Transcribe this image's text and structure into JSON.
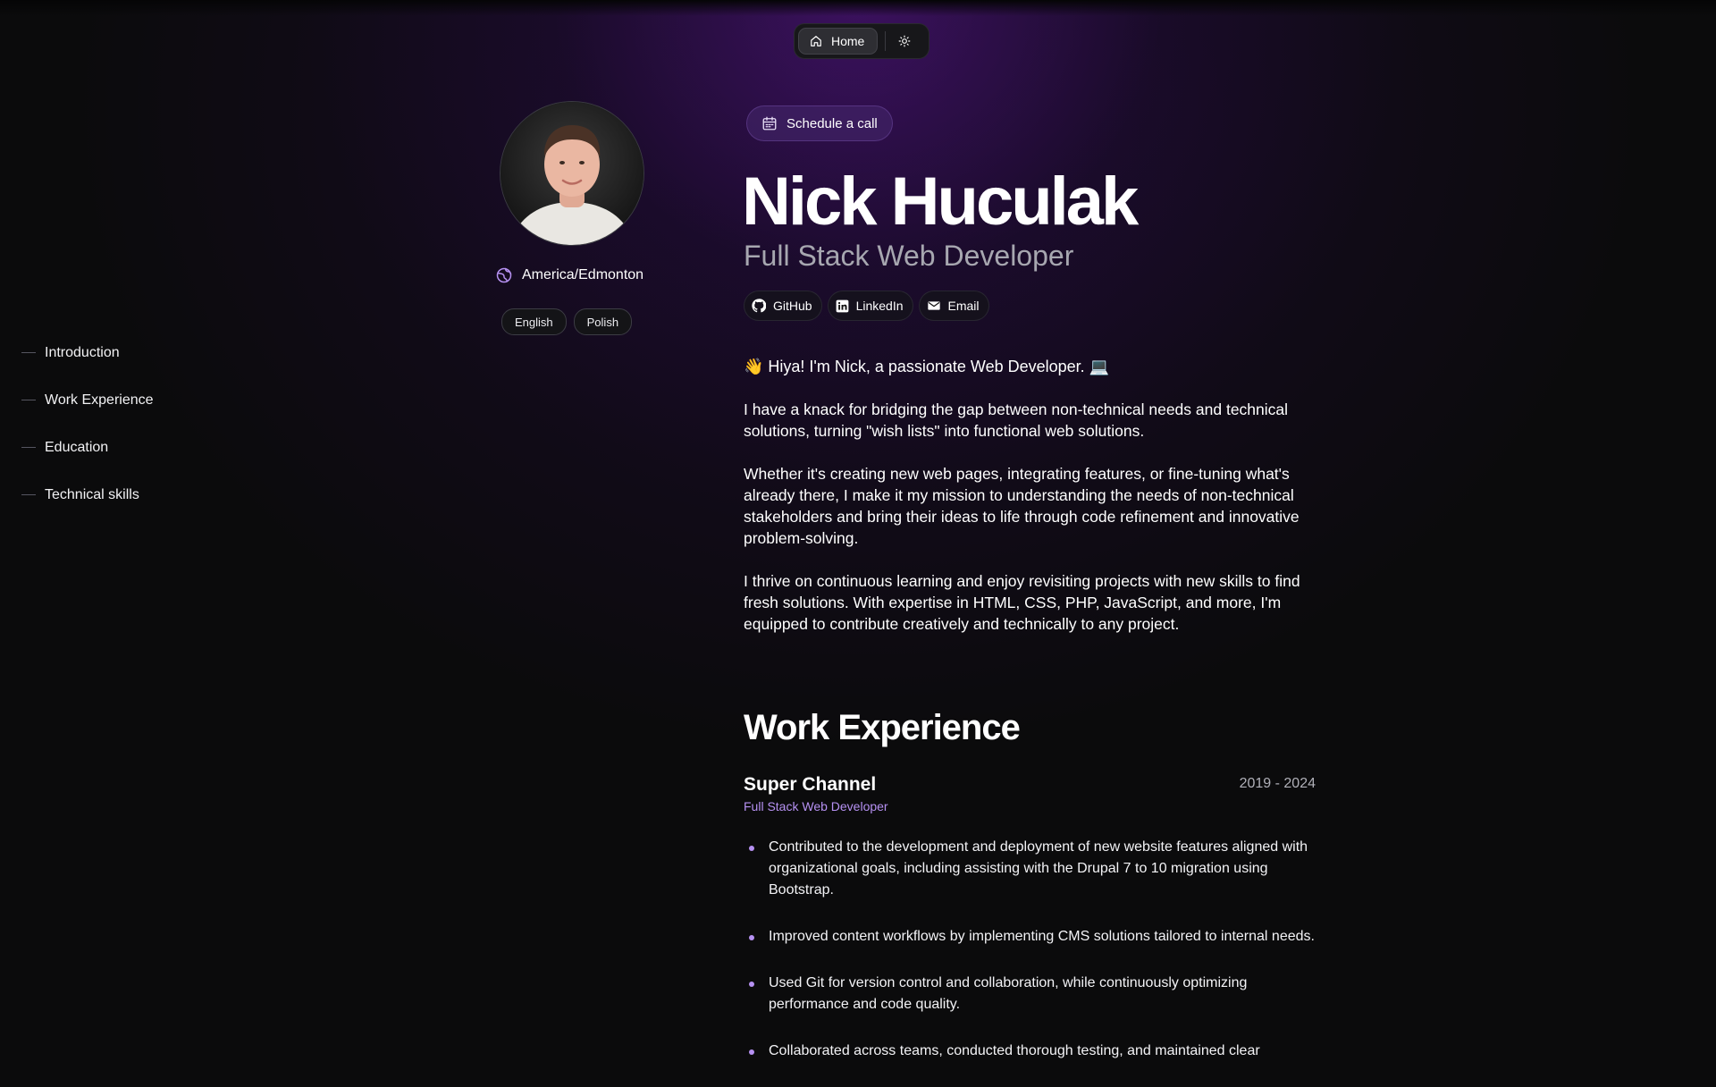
{
  "nav": {
    "home_label": "Home",
    "home_icon": "home-icon",
    "theme_icon": "sun-icon"
  },
  "toc": {
    "items": [
      {
        "label": "Introduction"
      },
      {
        "label": "Work Experience"
      },
      {
        "label": "Education"
      },
      {
        "label": "Technical skills"
      }
    ]
  },
  "profile": {
    "avatar": "avatar-photo",
    "location": "America/Edmonton",
    "location_icon": "globe-icon",
    "languages": [
      "English",
      "Polish"
    ]
  },
  "header": {
    "schedule_label": "Schedule a call",
    "schedule_icon": "calendar-icon",
    "name": "Nick Huculak",
    "role": "Full Stack Web Developer",
    "social": [
      {
        "label": "GitHub",
        "icon": "github-icon"
      },
      {
        "label": "LinkedIn",
        "icon": "linkedin-icon"
      },
      {
        "label": "Email",
        "icon": "email-icon"
      }
    ]
  },
  "intro": {
    "greeting": "👋 Hiya! I'm Nick, a passionate Web Developer. 💻",
    "paragraphs": [
      "I have a knack for bridging the gap between non-technical needs and technical solutions, turning \"wish lists\" into functional web solutions.",
      "Whether it's creating new web pages, integrating features, or fine-tuning what's already there, I make it my mission to understanding the needs of non-technical stakeholders and bring their ideas to life through code refinement and innovative problem-solving.",
      "I thrive on continuous learning and enjoy revisiting projects with new skills to find fresh solutions. With expertise in HTML, CSS, PHP, JavaScript, and more, I'm equipped to contribute creatively and technically to any project."
    ]
  },
  "work": {
    "title": "Work Experience",
    "jobs": [
      {
        "company": "Super Channel",
        "dates": "2019 - 2024",
        "role": "Full Stack Web Developer",
        "bullets": [
          "Contributed to the development and deployment of new website features aligned with organizational goals, including assisting with the Drupal 7 to 10 migration using Bootstrap.",
          "Improved content workflows by implementing CMS solutions tailored to internal needs.",
          "Used Git for version control and collaboration, while continuously optimizing performance and code quality.",
          "Collaborated across teams, conducted thorough testing, and maintained clear"
        ]
      }
    ]
  },
  "colors": {
    "accent": "#b691f2",
    "background": "#0b0b0c",
    "glow": "#3d1270"
  }
}
